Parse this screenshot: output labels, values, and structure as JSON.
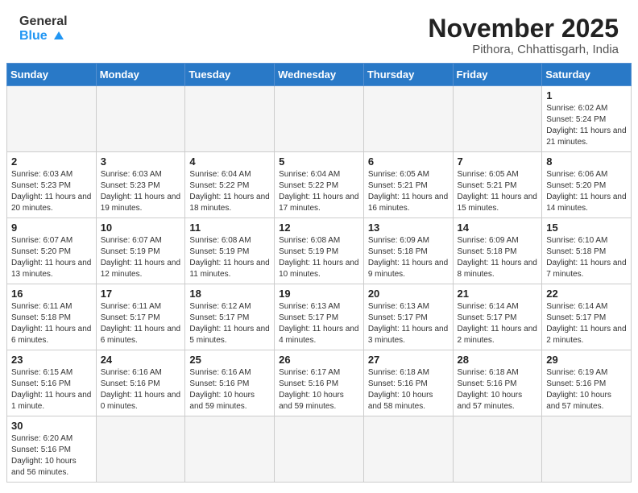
{
  "header": {
    "logo_general": "General",
    "logo_blue": "Blue",
    "month_title": "November 2025",
    "location": "Pithora, Chhattisgarh, India"
  },
  "weekdays": [
    "Sunday",
    "Monday",
    "Tuesday",
    "Wednesday",
    "Thursday",
    "Friday",
    "Saturday"
  ],
  "days": [
    {
      "date": "",
      "info": ""
    },
    {
      "date": "",
      "info": ""
    },
    {
      "date": "",
      "info": ""
    },
    {
      "date": "",
      "info": ""
    },
    {
      "date": "",
      "info": ""
    },
    {
      "date": "",
      "info": ""
    },
    {
      "date": "1",
      "info": "Sunrise: 6:02 AM\nSunset: 5:24 PM\nDaylight: 11 hours and 21 minutes."
    },
    {
      "date": "2",
      "info": "Sunrise: 6:03 AM\nSunset: 5:23 PM\nDaylight: 11 hours and 20 minutes."
    },
    {
      "date": "3",
      "info": "Sunrise: 6:03 AM\nSunset: 5:23 PM\nDaylight: 11 hours and 19 minutes."
    },
    {
      "date": "4",
      "info": "Sunrise: 6:04 AM\nSunset: 5:22 PM\nDaylight: 11 hours and 18 minutes."
    },
    {
      "date": "5",
      "info": "Sunrise: 6:04 AM\nSunset: 5:22 PM\nDaylight: 11 hours and 17 minutes."
    },
    {
      "date": "6",
      "info": "Sunrise: 6:05 AM\nSunset: 5:21 PM\nDaylight: 11 hours and 16 minutes."
    },
    {
      "date": "7",
      "info": "Sunrise: 6:05 AM\nSunset: 5:21 PM\nDaylight: 11 hours and 15 minutes."
    },
    {
      "date": "8",
      "info": "Sunrise: 6:06 AM\nSunset: 5:20 PM\nDaylight: 11 hours and 14 minutes."
    },
    {
      "date": "9",
      "info": "Sunrise: 6:07 AM\nSunset: 5:20 PM\nDaylight: 11 hours and 13 minutes."
    },
    {
      "date": "10",
      "info": "Sunrise: 6:07 AM\nSunset: 5:19 PM\nDaylight: 11 hours and 12 minutes."
    },
    {
      "date": "11",
      "info": "Sunrise: 6:08 AM\nSunset: 5:19 PM\nDaylight: 11 hours and 11 minutes."
    },
    {
      "date": "12",
      "info": "Sunrise: 6:08 AM\nSunset: 5:19 PM\nDaylight: 11 hours and 10 minutes."
    },
    {
      "date": "13",
      "info": "Sunrise: 6:09 AM\nSunset: 5:18 PM\nDaylight: 11 hours and 9 minutes."
    },
    {
      "date": "14",
      "info": "Sunrise: 6:09 AM\nSunset: 5:18 PM\nDaylight: 11 hours and 8 minutes."
    },
    {
      "date": "15",
      "info": "Sunrise: 6:10 AM\nSunset: 5:18 PM\nDaylight: 11 hours and 7 minutes."
    },
    {
      "date": "16",
      "info": "Sunrise: 6:11 AM\nSunset: 5:18 PM\nDaylight: 11 hours and 6 minutes."
    },
    {
      "date": "17",
      "info": "Sunrise: 6:11 AM\nSunset: 5:17 PM\nDaylight: 11 hours and 6 minutes."
    },
    {
      "date": "18",
      "info": "Sunrise: 6:12 AM\nSunset: 5:17 PM\nDaylight: 11 hours and 5 minutes."
    },
    {
      "date": "19",
      "info": "Sunrise: 6:13 AM\nSunset: 5:17 PM\nDaylight: 11 hours and 4 minutes."
    },
    {
      "date": "20",
      "info": "Sunrise: 6:13 AM\nSunset: 5:17 PM\nDaylight: 11 hours and 3 minutes."
    },
    {
      "date": "21",
      "info": "Sunrise: 6:14 AM\nSunset: 5:17 PM\nDaylight: 11 hours and 2 minutes."
    },
    {
      "date": "22",
      "info": "Sunrise: 6:14 AM\nSunset: 5:17 PM\nDaylight: 11 hours and 2 minutes."
    },
    {
      "date": "23",
      "info": "Sunrise: 6:15 AM\nSunset: 5:16 PM\nDaylight: 11 hours and 1 minute."
    },
    {
      "date": "24",
      "info": "Sunrise: 6:16 AM\nSunset: 5:16 PM\nDaylight: 11 hours and 0 minutes."
    },
    {
      "date": "25",
      "info": "Sunrise: 6:16 AM\nSunset: 5:16 PM\nDaylight: 10 hours and 59 minutes."
    },
    {
      "date": "26",
      "info": "Sunrise: 6:17 AM\nSunset: 5:16 PM\nDaylight: 10 hours and 59 minutes."
    },
    {
      "date": "27",
      "info": "Sunrise: 6:18 AM\nSunset: 5:16 PM\nDaylight: 10 hours and 58 minutes."
    },
    {
      "date": "28",
      "info": "Sunrise: 6:18 AM\nSunset: 5:16 PM\nDaylight: 10 hours and 57 minutes."
    },
    {
      "date": "29",
      "info": "Sunrise: 6:19 AM\nSunset: 5:16 PM\nDaylight: 10 hours and 57 minutes."
    },
    {
      "date": "30",
      "info": "Sunrise: 6:20 AM\nSunset: 5:16 PM\nDaylight: 10 hours and 56 minutes."
    },
    {
      "date": "",
      "info": ""
    },
    {
      "date": "",
      "info": ""
    },
    {
      "date": "",
      "info": ""
    },
    {
      "date": "",
      "info": ""
    },
    {
      "date": "",
      "info": ""
    },
    {
      "date": "",
      "info": ""
    }
  ]
}
